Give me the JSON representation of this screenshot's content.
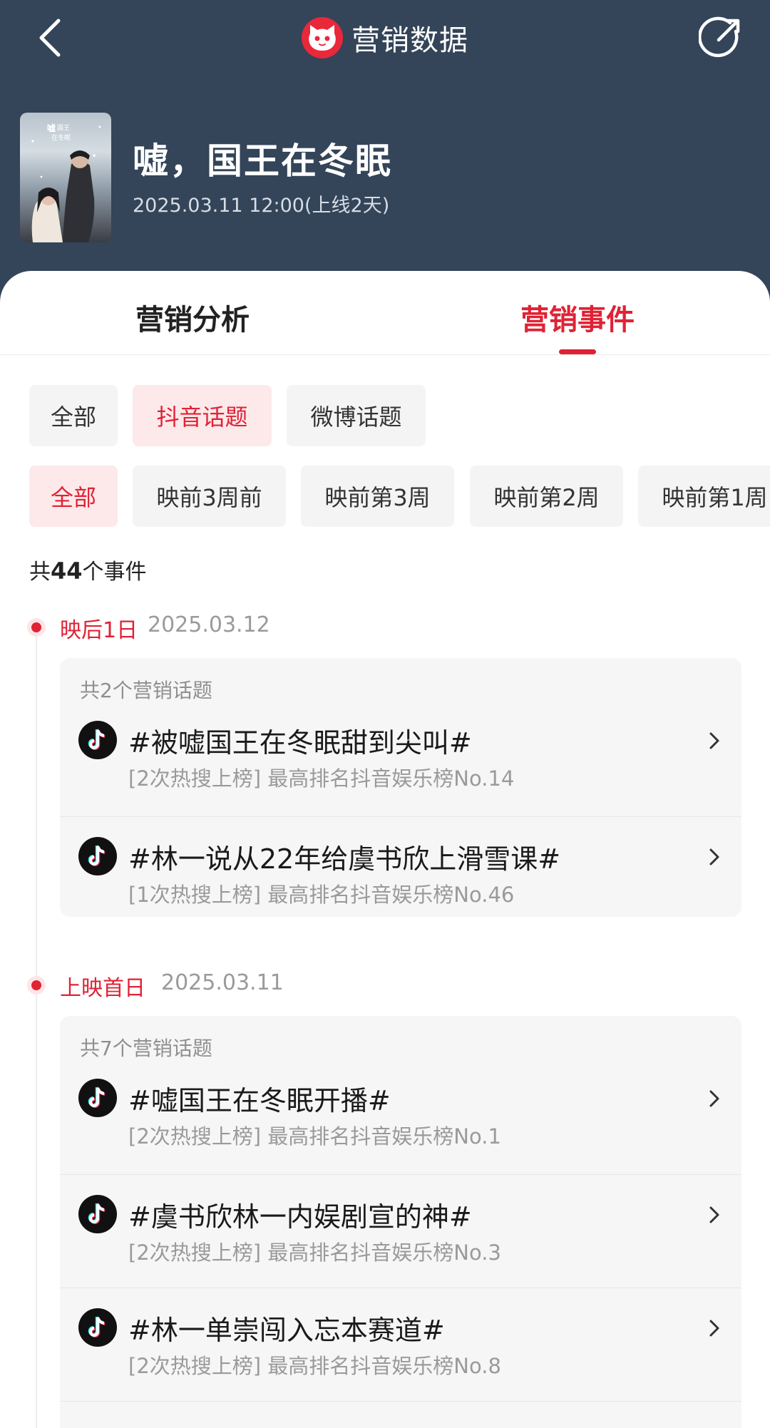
{
  "header": {
    "title": "营销数据",
    "movie_title": "嘘，国王在冬眠",
    "release": "2025.03.11 12:00(上线2天)"
  },
  "tabs": [
    {
      "label": "营销分析",
      "active": false
    },
    {
      "label": "营销事件",
      "active": true
    }
  ],
  "source_filters": [
    {
      "label": "全部",
      "active": false
    },
    {
      "label": "抖音话题",
      "active": true
    },
    {
      "label": "微博话题",
      "active": false
    }
  ],
  "period_filters": [
    {
      "label": "全部",
      "active": true
    },
    {
      "label": "映前3周前",
      "active": false
    },
    {
      "label": "映前第3周",
      "active": false
    },
    {
      "label": "映前第2周",
      "active": false
    },
    {
      "label": "映前第1周",
      "active": false
    }
  ],
  "event_count": {
    "prefix": "共",
    "number": "44",
    "suffix": "个事件"
  },
  "groups": [
    {
      "label": "映后1日",
      "date": "2025.03.12",
      "count_text": "共2个营销话题",
      "topics": [
        {
          "title": "#被嘘国王在冬眠甜到尖叫#",
          "meta": "[2次热搜上榜] 最高排名抖音娱乐榜No.14"
        },
        {
          "title": "#林一说从22年给虞书欣上滑雪课#",
          "meta": "[1次热搜上榜] 最高排名抖音娱乐榜No.46"
        }
      ]
    },
    {
      "label": "上映首日",
      "date": "2025.03.11",
      "count_text": "共7个营销话题",
      "topics": [
        {
          "title": "#嘘国王在冬眠开播#",
          "meta": "[2次热搜上榜] 最高排名抖音娱乐榜No.1"
        },
        {
          "title": "#虞书欣林一内娱剧宣的神#",
          "meta": "[2次热搜上榜] 最高排名抖音娱乐榜No.3"
        },
        {
          "title": "#林一单崇闯入忘本赛道#",
          "meta": "[2次热搜上榜] 最高排名抖音娱乐榜No.8"
        }
      ]
    }
  ],
  "colors": {
    "header_bg": "#344459",
    "accent": "#e02235",
    "chip_bg": "#f4f4f4",
    "chip_active_bg": "#fde9ea"
  },
  "icons": [
    "back-arrow-icon",
    "maoyan-cat-logo",
    "share-icon",
    "douyin-icon",
    "chevron-right-icon"
  ]
}
